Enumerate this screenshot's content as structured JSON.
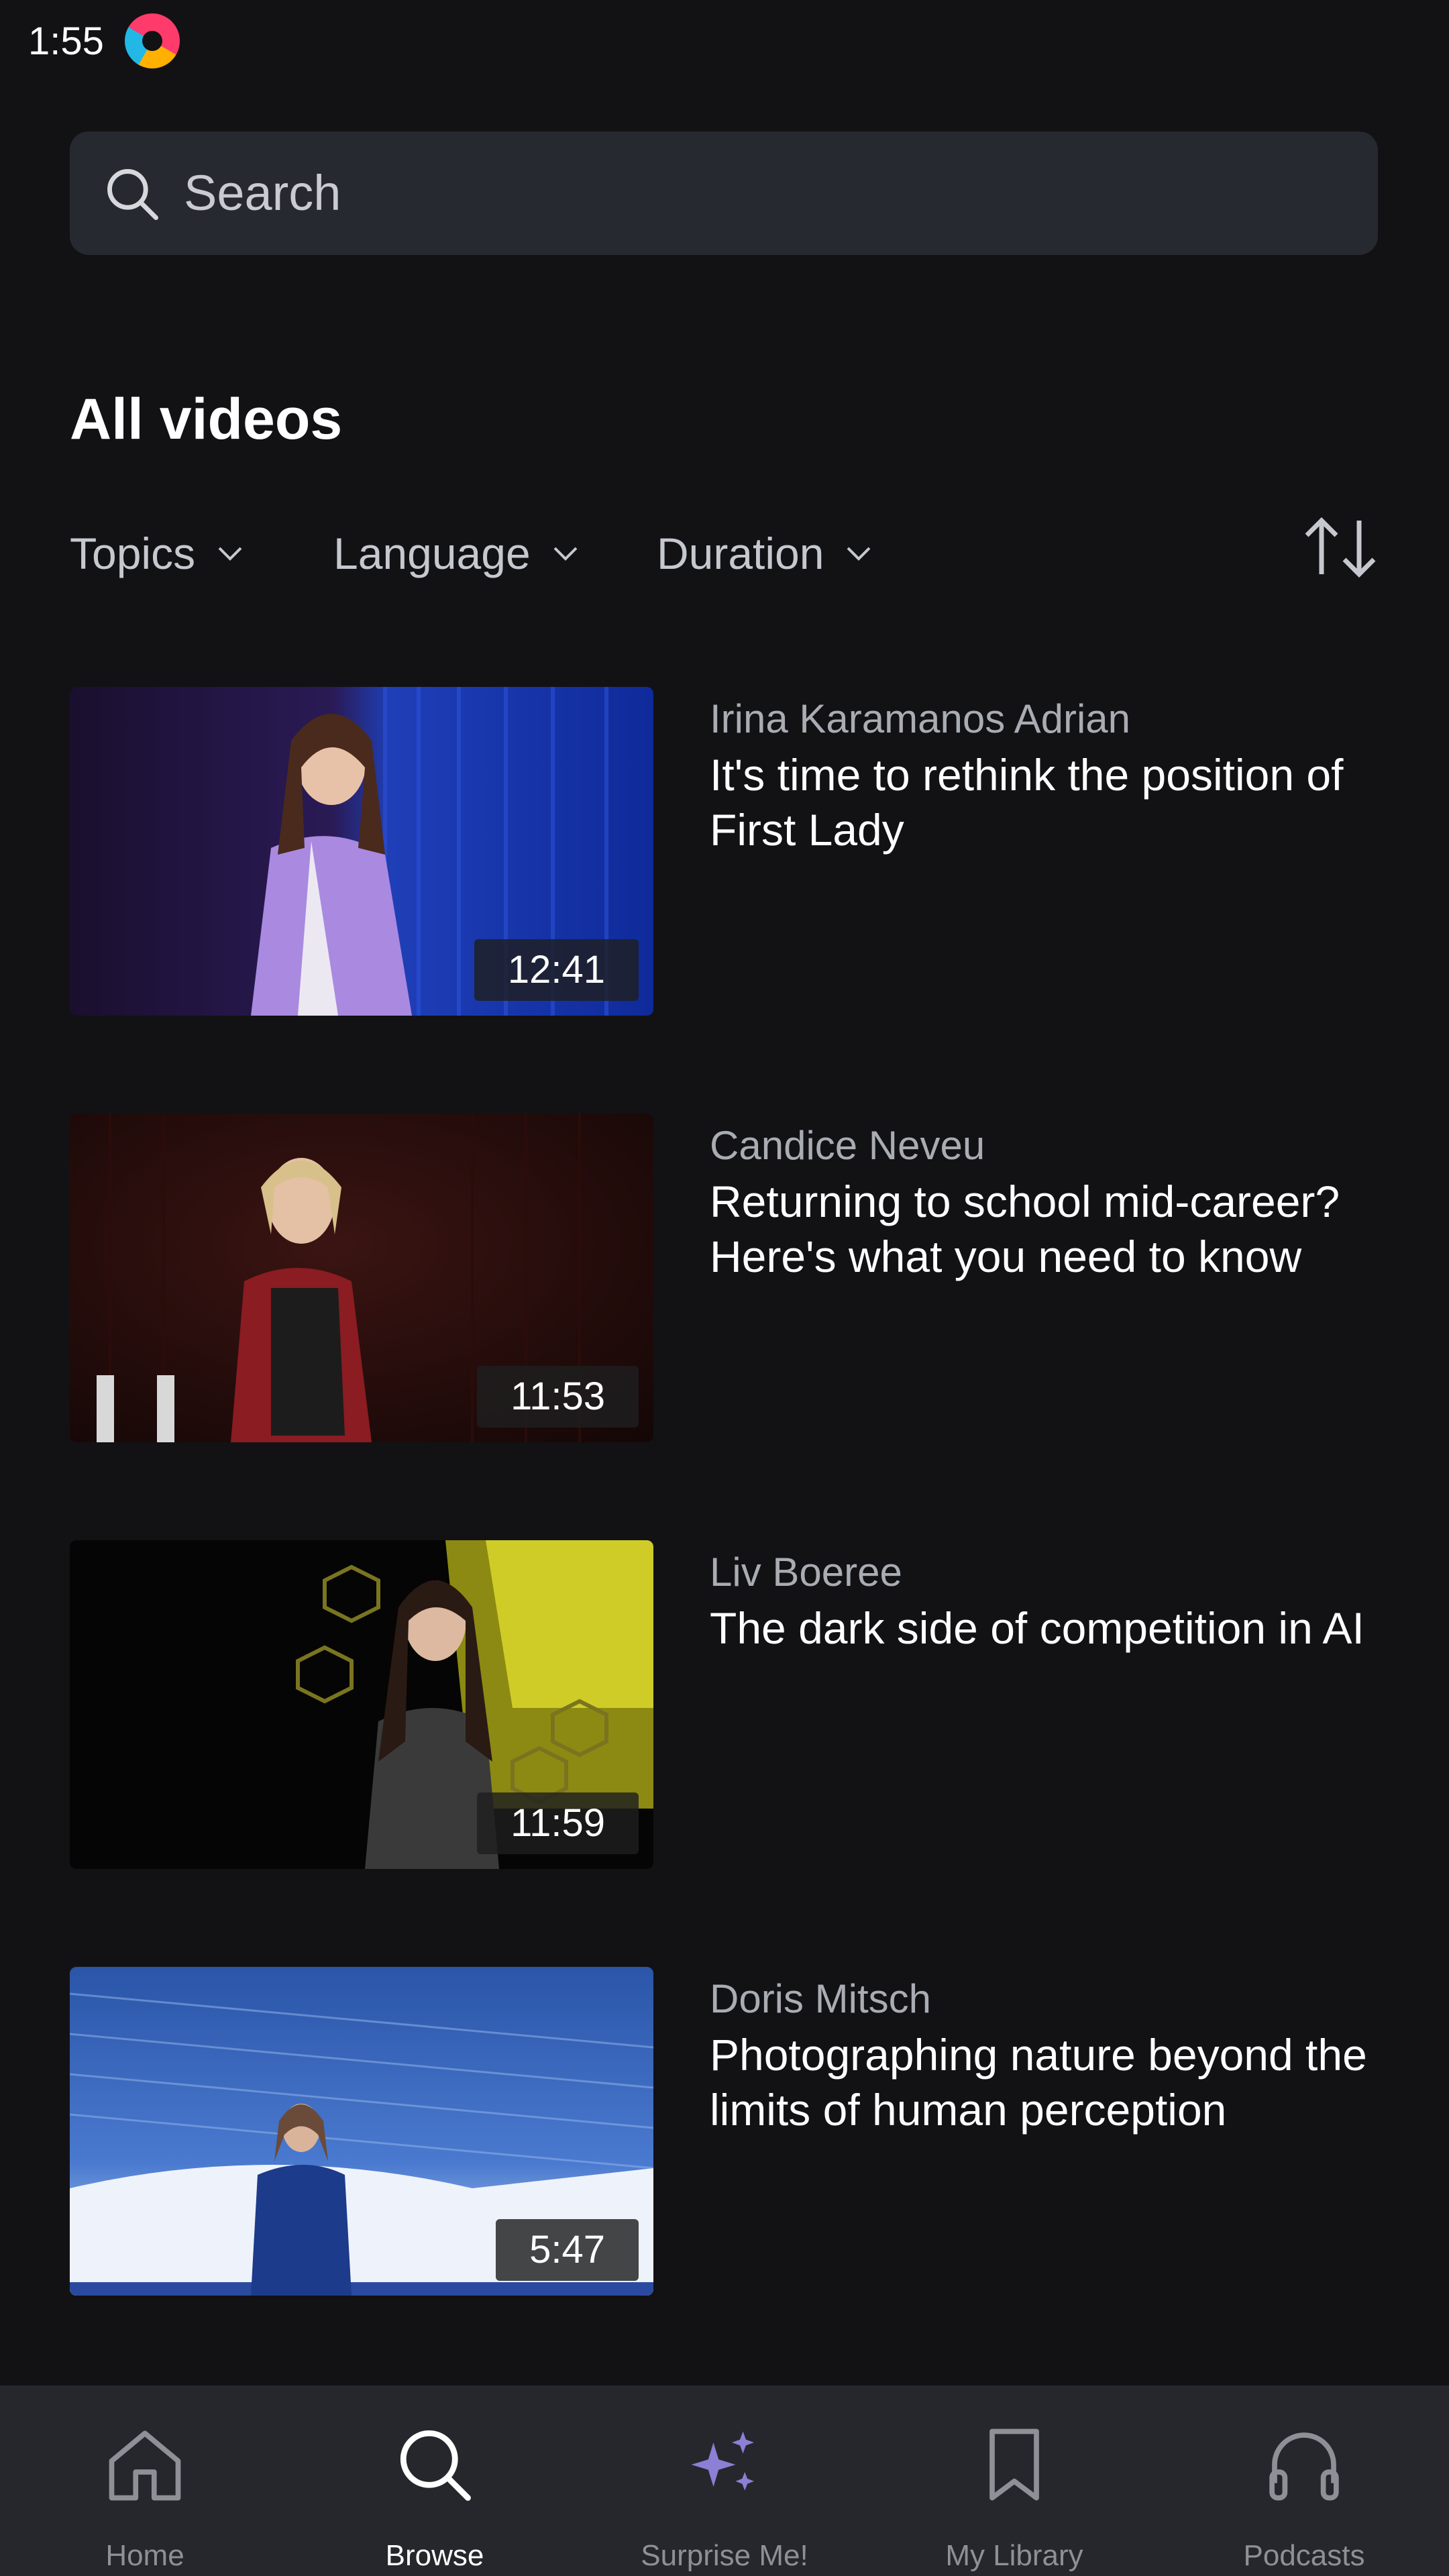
{
  "status_bar": {
    "time": "1:55"
  },
  "search": {
    "placeholder": "Search"
  },
  "page": {
    "heading": "All videos"
  },
  "filters": [
    {
      "label": "Topics"
    },
    {
      "label": "Language"
    },
    {
      "label": "Duration"
    }
  ],
  "videos": [
    {
      "speaker": "Irina Karamanos Adrian",
      "title": "It's time to rethink the position of First Lady",
      "duration": "12:41"
    },
    {
      "speaker": "Candice Neveu",
      "title": "Returning to school mid-career? Here's what you need to know",
      "duration": "11:53"
    },
    {
      "speaker": "Liv Boeree",
      "title": "The dark side of competition in AI",
      "duration": "11:59"
    },
    {
      "speaker": "Doris Mitsch",
      "title": "Photographing nature beyond the limits of human perception",
      "duration": "5:47"
    }
  ],
  "bottom_nav": {
    "active": "Browse",
    "items": [
      {
        "label": "Home",
        "icon": "home-icon"
      },
      {
        "label": "Browse",
        "icon": "search-icon"
      },
      {
        "label": "Surprise Me!",
        "icon": "sparkles-icon"
      },
      {
        "label": "My Library",
        "icon": "bookmark-icon"
      },
      {
        "label": "Podcasts",
        "icon": "headphones-icon"
      }
    ]
  },
  "colors": {
    "background": "#121214",
    "search_bg": "#26292f",
    "nav_bg": "#25272c",
    "muted_text": "#a9acb3",
    "accent_sparkle": "#8b7fd6"
  }
}
